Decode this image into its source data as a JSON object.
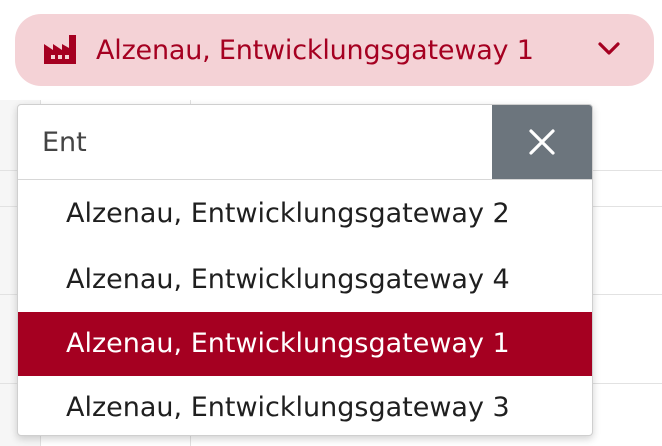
{
  "location_selector": {
    "icon": "factory-icon",
    "label": "Alzenau, Entwicklungsgateway 1",
    "chevron_icon": "chevron-down-icon",
    "accent_color": "#a50021",
    "background_color": "#f4d2d6"
  },
  "dropdown": {
    "search": {
      "value": "Ent",
      "placeholder": ""
    },
    "clear_icon": "close-icon",
    "clear_button_color": "#6c757d",
    "options": [
      {
        "label": "Alzenau, Entwicklungsgateway 2",
        "selected": false
      },
      {
        "label": "Alzenau, Entwicklungsgateway 4",
        "selected": false
      },
      {
        "label": "Alzenau, Entwicklungsgateway 1",
        "selected": true
      },
      {
        "label": "Alzenau, Entwicklungsgateway 3",
        "selected": false
      }
    ],
    "selected_color": "#a50021"
  }
}
